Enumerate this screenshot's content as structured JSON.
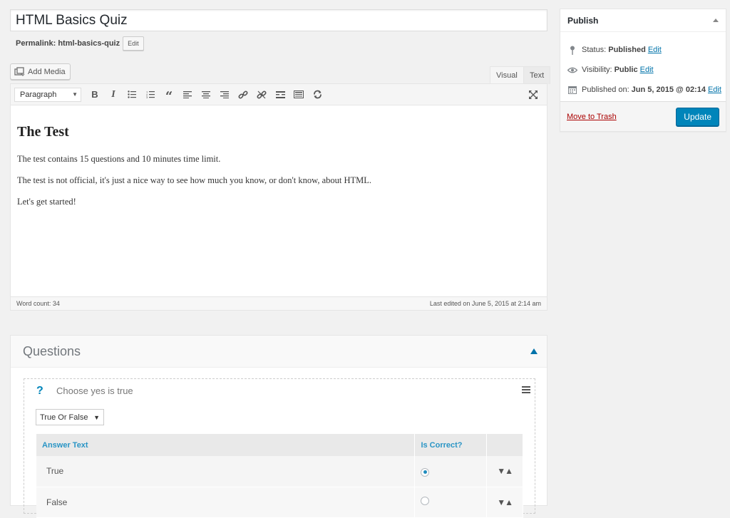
{
  "post": {
    "title": "HTML Basics Quiz",
    "permalink_label": "Permalink:",
    "permalink_slug": "html-basics-quiz",
    "permalink_edit": "Edit"
  },
  "media": {
    "add_label": "Add Media"
  },
  "editor": {
    "tabs": {
      "visual": "Visual",
      "text": "Text"
    },
    "format": "Paragraph",
    "toolbar_icons": [
      "bold-icon",
      "italic-icon",
      "bulleted-list-icon",
      "numbered-list-icon",
      "blockquote-icon",
      "align-left-icon",
      "align-center-icon",
      "align-right-icon",
      "link-icon",
      "unlink-icon",
      "read-more-icon",
      "toolbar-toggle-icon",
      "refresh-icon",
      "fullscreen-icon"
    ],
    "heading": "The Test",
    "paragraphs": [
      "The test contains 15 questions and 10 minutes time limit.",
      "The test is not official, it's just a nice way to see how much you know, or don't know, about HTML.",
      "Let's get started!"
    ],
    "word_count": "Word count: 34",
    "last_edited": "Last edited on June 5, 2015 at 2:14 am"
  },
  "publish": {
    "title": "Publish",
    "status_label": "Status:",
    "status_value": "Published",
    "visibility_label": "Visibility:",
    "visibility_value": "Public",
    "published_label": "Published on:",
    "published_value": "Jun 5, 2015 @ 02:14",
    "edit": "Edit",
    "trash": "Move to Trash",
    "update": "Update",
    "accent_color": "#0085ba"
  },
  "questions": {
    "title": "Questions",
    "item": {
      "icon": "?",
      "title": "Choose yes is true",
      "type": "True Or False",
      "columns": {
        "answer": "Answer Text",
        "correct": "Is Correct?"
      },
      "answers": [
        {
          "text": "True",
          "correct": true
        },
        {
          "text": "False",
          "correct": false
        }
      ]
    }
  }
}
